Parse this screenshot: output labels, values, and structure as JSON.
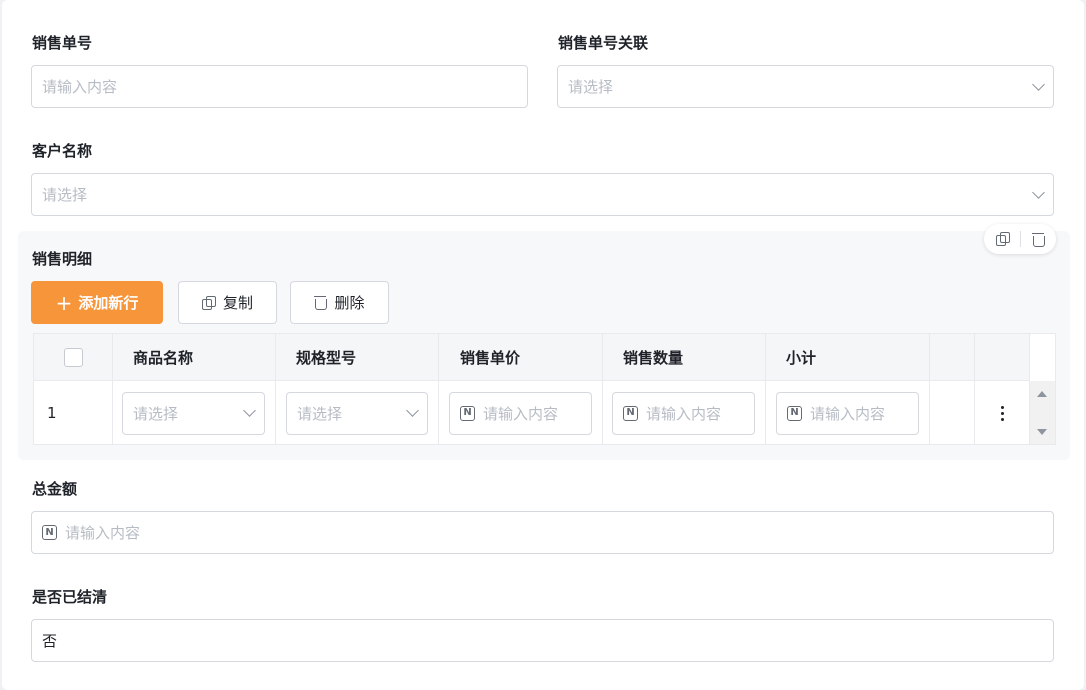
{
  "form": {
    "sales_no": {
      "label": "销售单号",
      "placeholder": "请输入内容"
    },
    "sales_no_link": {
      "label": "销售单号关联",
      "placeholder": "请选择"
    },
    "customer_name": {
      "label": "客户名称",
      "placeholder": "请选择"
    },
    "total_amount": {
      "label": "总金额",
      "placeholder": "请输入内容"
    },
    "settled": {
      "label": "是否已结清",
      "value": "否"
    }
  },
  "subform": {
    "title": "销售明细",
    "actions": {
      "copy_icon": "copy-icon",
      "delete_icon": "trash-icon"
    },
    "toolbar": {
      "add_row": "添加新行",
      "copy": "复制",
      "delete": "删除"
    },
    "columns": [
      "商品名称",
      "规格型号",
      "销售单价",
      "销售数量",
      "小计"
    ],
    "rows": [
      {
        "index": "1",
        "product": "请选择",
        "spec": "请选择",
        "price": "请输入内容",
        "quantity": "请输入内容",
        "subtotal": "请输入内容"
      }
    ]
  },
  "colors": {
    "primary": "#f7953b",
    "border": "#d5d8de",
    "placeholder": "#b7bcc4",
    "text": "#1f2329"
  }
}
